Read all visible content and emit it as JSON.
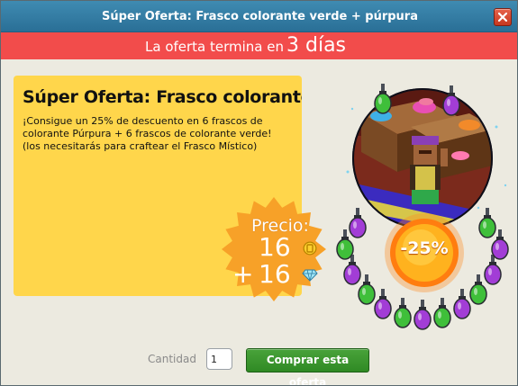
{
  "window": {
    "title": "Súper Oferta: Frasco colorante verde + púrpura"
  },
  "banner": {
    "label": "La oferta termina en",
    "days": "3 días"
  },
  "offer": {
    "heading": "Súper Oferta: Frasco colorante verde",
    "description": "¡Consigue un 25% de descuento en 6 frascos de colorante Púrpura + 6 frascos de colorante verde! (los necesitarás para craftear el Frasco Místico)"
  },
  "price": {
    "label": "Precio:",
    "credits": "16",
    "plus": "+",
    "diamonds": "16",
    "credits_icon": "gold-coin-icon",
    "diamonds_icon": "diamond-icon"
  },
  "discount": {
    "label": "-25%"
  },
  "purchase": {
    "quantity_label": "Cantidad",
    "quantity_value": "1",
    "buy_label": "Comprar esta oferta"
  },
  "colors": {
    "titlebar": "#3a82ab",
    "banner": "#f24c4b",
    "card": "#ffd64b",
    "price_burst": "#f79a1e",
    "buy_button": "#3f9a31"
  }
}
